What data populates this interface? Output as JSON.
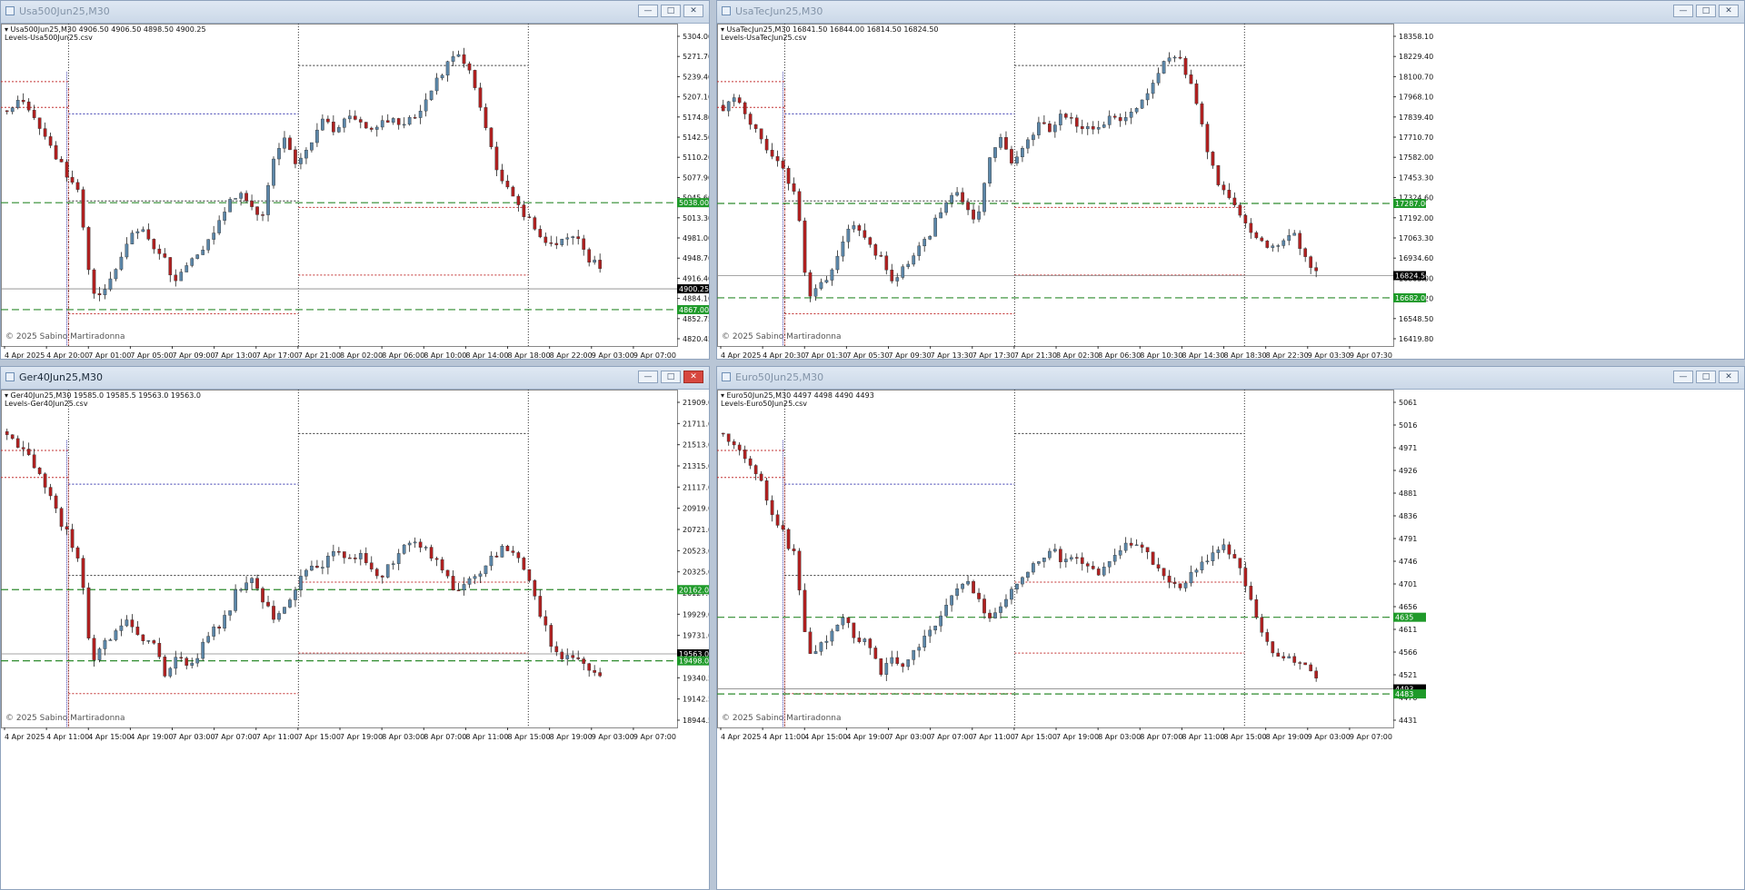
{
  "windows": [
    {
      "id": "usa500",
      "title": "Usa500Jun25,M30",
      "active": false,
      "symbol_line": "Usa500Jun25,M30  4906.50 4906.50 4898.50 4900.25",
      "levels_label": "Levels-Usa500Jun25.csv",
      "copyright": "© 2025 Sabino Martiradonna",
      "y_ticks": [
        "5304.00",
        "5271.70",
        "5239.40",
        "5207.10",
        "5174.80",
        "5142.50",
        "5110.20",
        "5077.90",
        "5045.60",
        "5013.30",
        "4981.00",
        "4948.70",
        "4916.40",
        "4884.10",
        "4852.75",
        "4820.45"
      ],
      "x_ticks": [
        "4 Apr 2025",
        "4 Apr 20:00",
        "7 Apr 01:00",
        "7 Apr 05:00",
        "7 Apr 09:00",
        "7 Apr 13:00",
        "7 Apr 17:00",
        "7 Apr 21:00",
        "8 Apr 02:00",
        "8 Apr 06:00",
        "8 Apr 10:00",
        "8 Apr 14:00",
        "8 Apr 18:00",
        "8 Apr 22:00",
        "9 Apr 03:00",
        "9 Apr 07:00"
      ],
      "price_tags": [
        {
          "text": "5038.00",
          "color": "#1f9a2a",
          "value": 5038.0
        },
        {
          "text": "4900.25",
          "color": "#000000",
          "value": 4900.25
        },
        {
          "text": "4867.00",
          "color": "#1f9a2a",
          "value": 4867.0
        }
      ]
    },
    {
      "id": "usatec",
      "title": "UsaTecJun25,M30",
      "active": false,
      "symbol_line": "UsaTecJun25,M30  16841.50 16844.00 16814.50 16824.50",
      "levels_label": "Levels-UsaTecJun25.csv",
      "copyright": "© 2025 Sabino Martiradonna",
      "y_ticks": [
        "18358.10",
        "18229.40",
        "18100.70",
        "17968.10",
        "17839.40",
        "17710.70",
        "17582.00",
        "17453.30",
        "17324.60",
        "17192.00",
        "17063.30",
        "16934.60",
        "16805.90",
        "16677.20",
        "16548.50",
        "16419.80"
      ],
      "x_ticks": [
        "4 Apr 2025",
        "4 Apr 20:30",
        "7 Apr 01:30",
        "7 Apr 05:30",
        "7 Apr 09:30",
        "7 Apr 13:30",
        "7 Apr 17:30",
        "7 Apr 21:30",
        "8 Apr 02:30",
        "8 Apr 06:30",
        "8 Apr 10:30",
        "8 Apr 14:30",
        "8 Apr 18:30",
        "8 Apr 22:30",
        "9 Apr 03:30",
        "9 Apr 07:30"
      ],
      "price_tags": [
        {
          "text": "17287.00",
          "color": "#1f9a2a",
          "value": 17287.0
        },
        {
          "text": "16824.50",
          "color": "#000000",
          "value": 16824.5
        },
        {
          "text": "16682.00",
          "color": "#1f9a2a",
          "value": 16682.0
        }
      ]
    },
    {
      "id": "ger40",
      "title": "Ger40Jun25,M30",
      "active": true,
      "symbol_line": "Ger40Jun25,M30  19585.0 19585.5 19563.0 19563.0",
      "levels_label": "Levels-Ger40Jun25.csv",
      "copyright": "© 2025 Sabino Martiradonna",
      "y_ticks": [
        "21909.0",
        "21711.0",
        "21513.0",
        "21315.0",
        "21117.0",
        "20919.0",
        "20721.0",
        "20523.0",
        "20325.0",
        "20127.0",
        "19929.0",
        "19731.0",
        "19538.0",
        "19340.5",
        "19142.5",
        "18944.5"
      ],
      "x_ticks": [
        "4 Apr 2025",
        "4 Apr 11:00",
        "4 Apr 15:00",
        "4 Apr 19:00",
        "7 Apr 03:00",
        "7 Apr 07:00",
        "7 Apr 11:00",
        "7 Apr 15:00",
        "7 Apr 19:00",
        "8 Apr 03:00",
        "8 Apr 07:00",
        "8 Apr 11:00",
        "8 Apr 15:00",
        "8 Apr 19:00",
        "9 Apr 03:00",
        "9 Apr 07:00"
      ],
      "price_tags": [
        {
          "text": "20162.0",
          "color": "#1f9a2a",
          "value": 20162.0
        },
        {
          "text": "19563.0",
          "color": "#000000",
          "value": 19563.0
        },
        {
          "text": "19498.0",
          "color": "#1f9a2a",
          "value": 19498.0
        }
      ]
    },
    {
      "id": "euro50",
      "title": "Euro50Jun25,M30",
      "active": false,
      "symbol_line": "Euro50Jun25,M30  4497 4498 4490 4493",
      "levels_label": "Levels-Euro50Jun25.csv",
      "copyright": "© 2025 Sabino Martiradonna",
      "y_ticks": [
        "5061",
        "5016",
        "4971",
        "4926",
        "4881",
        "4836",
        "4791",
        "4746",
        "4701",
        "4656",
        "4611",
        "4566",
        "4521",
        "4476",
        "4431"
      ],
      "x_ticks": [
        "4 Apr 2025",
        "4 Apr 11:00",
        "4 Apr 15:00",
        "4 Apr 19:00",
        "7 Apr 03:00",
        "7 Apr 07:00",
        "7 Apr 11:00",
        "7 Apr 15:00",
        "7 Apr 19:00",
        "8 Apr 03:00",
        "8 Apr 07:00",
        "8 Apr 11:00",
        "8 Apr 15:00",
        "8 Apr 19:00",
        "9 Apr 03:00",
        "9 Apr 07:00"
      ],
      "price_tags": [
        {
          "text": "4635",
          "color": "#1f9a2a",
          "value": 4635
        },
        {
          "text": "4493",
          "color": "#000000",
          "value": 4493
        },
        {
          "text": "4483",
          "color": "#1f9a2a",
          "value": 4483
        }
      ]
    }
  ],
  "colors": {
    "bull": "#5b86a8",
    "bear": "#b02020",
    "support_line": "#2e8b2e",
    "blue_dot": "#3b3bb0",
    "red_dot": "#c23030",
    "grid_dot": "#333333"
  }
}
